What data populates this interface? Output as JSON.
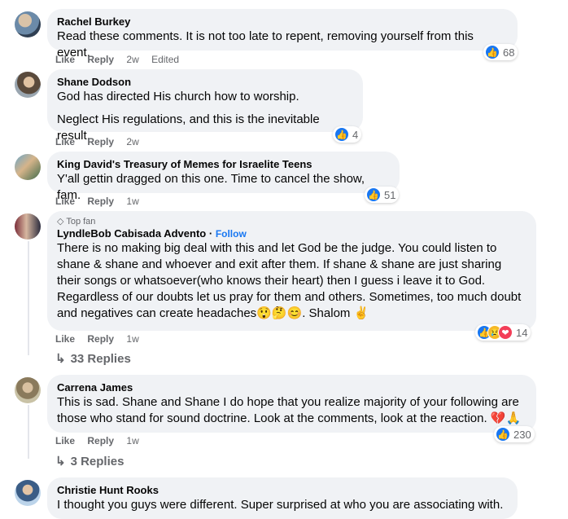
{
  "comments": [
    {
      "name": "Rachel Burkey",
      "text": [
        "Read these comments. It is not too late to repent, removing yourself from this event."
      ],
      "like": "Like",
      "reply": "Reply",
      "time": "2w",
      "edited": "Edited",
      "reactions": [
        "like-icon"
      ],
      "count": "68"
    },
    {
      "name": "Shane Dodson",
      "text": [
        "God has directed His church how to worship.",
        "Neglect His regulations, and this is the inevitable result."
      ],
      "like": "Like",
      "reply": "Reply",
      "time": "2w",
      "reactions": [
        "like-icon"
      ],
      "count": "4"
    },
    {
      "name": "King David's Treasury of Memes for Israelite Teens",
      "text": [
        "Y'all gettin dragged on this one. Time to cancel the show, fam."
      ],
      "like": "Like",
      "reply": "Reply",
      "time": "1w",
      "reactions": [
        "like-icon"
      ],
      "count": "51"
    },
    {
      "badge": "Top fan",
      "name": "LyndleBob Cabisada Advento",
      "follow": "Follow",
      "text": [
        "There is no making big deal with this and let God be the judge. You could listen to shane & shane and whoever and exit after them. If shane & shane are just sharing their songs or whatsoever(who knows their heart) then I guess i leave it to God. Regardless of our doubts let us pray for them and others. Sometimes, too much doubt and negatives can create headaches😲🤔😊. Shalom ✌"
      ],
      "like": "Like",
      "reply": "Reply",
      "time": "1w",
      "reactions": [
        "like-icon",
        "sad-icon",
        "heart-icon"
      ],
      "count": "14",
      "replies": "33 Replies"
    },
    {
      "name": "Carrena James",
      "text": [
        "This is sad. Shane and Shane I do hope that you realize majority of your following are those who stand for sound doctrine. Look at the comments, look at the reaction. 💔🙏"
      ],
      "like": "Like",
      "reply": "Reply",
      "time": "1w",
      "reactions": [
        "like-icon"
      ],
      "count": "230",
      "replies": "3 Replies"
    },
    {
      "name": "Christie Hunt Rooks",
      "text": [
        "I thought you guys were different. Super surprised at who you are associating with."
      ]
    }
  ],
  "icons": {
    "like": "like-icon",
    "sad": "sad-icon",
    "heart": "heart-icon",
    "reply_arrow": "reply-arrow-icon",
    "top_fan": "diamond-icon"
  },
  "colors": {
    "bubble": "#f0f2f5",
    "like": "#1877f2",
    "meta": "#65676b",
    "follow": "#1877f2"
  }
}
